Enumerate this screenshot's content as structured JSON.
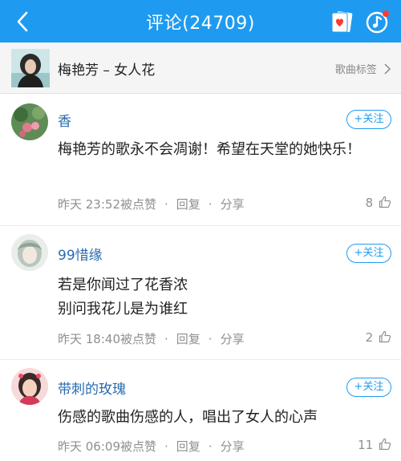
{
  "header": {
    "title": "评论(24709)",
    "bg_color": "#1e9bf0",
    "back_icon": "chevron-left-icon",
    "card_icon": "card-heart-icon",
    "music_icon": "music-disc-icon",
    "badge_color": "#ff3b30"
  },
  "song": {
    "name": "梅艳芳 – 女人花",
    "tag_link": "歌曲标签"
  },
  "comments": [
    {
      "user": "香",
      "follow": "+关注",
      "text": "梅艳芳的歌永不会凋谢！希望在天堂的她快乐！",
      "time": "昨天 23:52被点赞",
      "reply": "回复",
      "share": "分享",
      "likes": "8"
    },
    {
      "user": "99惜缘",
      "follow": "+关注",
      "text_lines": [
        "若是你闻过了花香浓",
        "别问我花儿是为谁红"
      ],
      "time": "昨天 18:40被点赞",
      "reply": "回复",
      "share": "分享",
      "likes": "2"
    },
    {
      "user": "带刺的玫瑰",
      "follow": "+关注",
      "text": "伤感的歌曲伤感的人，唱出了女人的心声",
      "time": "昨天 06:09被点赞",
      "reply": "回复",
      "share": "分享",
      "likes": "11"
    }
  ]
}
